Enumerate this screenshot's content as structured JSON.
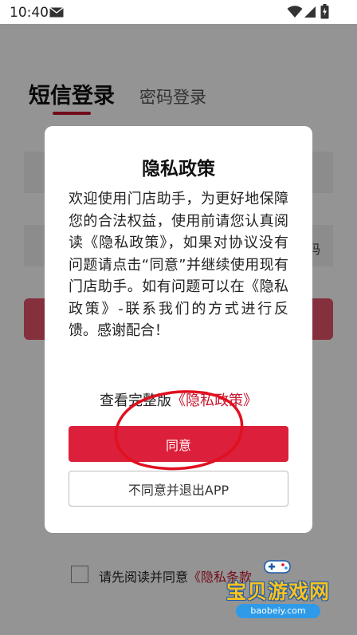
{
  "status_bar": {
    "time": "10:40"
  },
  "login": {
    "tab_sms": "短信登录",
    "tab_password": "密码登录",
    "get_code_peek": "码",
    "agree_prefix": "请先阅读并同意",
    "agree_link": "《隐私条款"
  },
  "dialog": {
    "title": "隐私政策",
    "body": "欢迎使用门店助手，为更好地保障您的合法权益，使用前请您认真阅读《隐私政策》，如果对协议没有问题请点击“同意”并继续使用现有门店助手。如有问题可以在《隐私政策》-联系我们的方式进行反馈。感谢配合！",
    "full_policy_prefix": "查看完整版",
    "full_policy_link": "《隐私政策》",
    "agree_button": "同意",
    "disagree_button": "不同意并退出APP"
  },
  "watermark": {
    "text_cn": "宝贝游戏网",
    "text_en": "baobeiy.com"
  },
  "colors": {
    "accent": "#dc1f3a",
    "link": "#c5162e",
    "annotation": "#e01020"
  },
  "icons": [
    "mail-icon",
    "wifi-icon",
    "signal-icon",
    "battery-icon",
    "gamepad-icon"
  ]
}
